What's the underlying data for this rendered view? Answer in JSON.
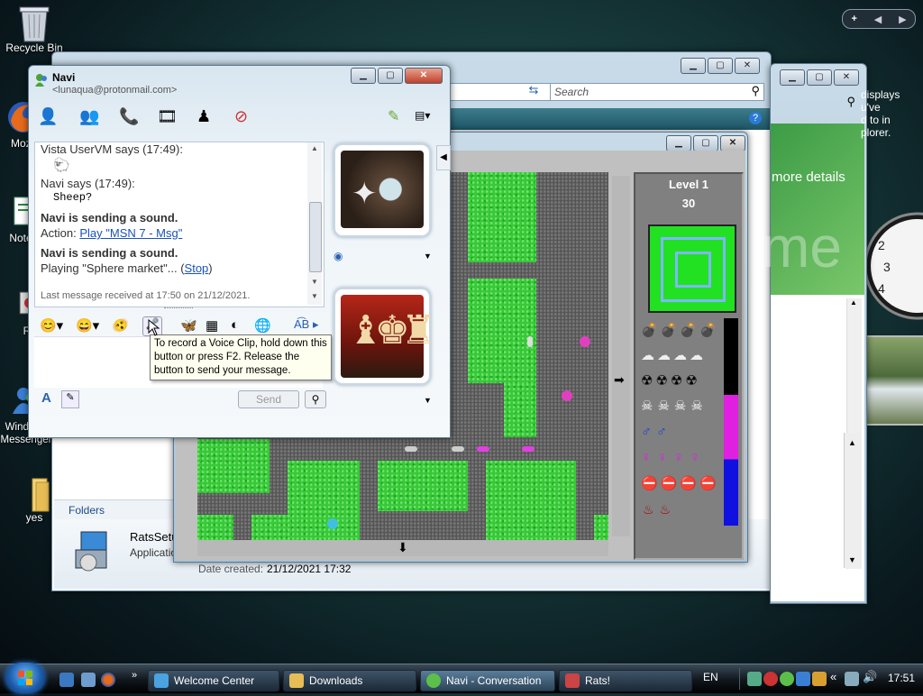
{
  "desktop": {
    "icons": [
      {
        "label": "Recycle Bin"
      },
      {
        "label": "Mozilla Firefox"
      },
      {
        "label": "Notes"
      },
      {
        "label": "R"
      },
      {
        "label": "Windows Messenger"
      },
      {
        "label": "yes"
      }
    ],
    "gadget_text": [
      "displays",
      "u've",
      "d to in",
      "plorer."
    ],
    "gadget_top_buttons": [
      "+",
      "◀",
      "▶"
    ]
  },
  "explorer": {
    "search_placeholder": "Search",
    "more_details": "more details",
    "folders_label": "Folders",
    "file_name": "RatsSetup",
    "file_type": "Application",
    "date_created_label": "Date created:",
    "date_created_value": "21/12/2021 17:32",
    "watermark": "me"
  },
  "messenger": {
    "title": "Navi",
    "email": "<lunaqua@protonmail.com>",
    "messages": [
      {
        "header": "Vista UserVM says (17:49):"
      },
      {
        "header": "Navi says (17:49):",
        "body": "Sheep?"
      }
    ],
    "sound1_bold": "Navi is sending a sound.",
    "sound1_action_label": "Action:",
    "sound1_action_link": "Play \"MSN 7 - Msg\"",
    "sound2_bold": "Navi is sending a sound.",
    "sound2_playing": "Playing \"Sphere market\"...",
    "sound2_stop": "Stop",
    "status": "Last message received at 17:50 on 21/12/2021.",
    "tooltip": "To record a Voice Clip, hold down this button or press F2. Release the button to send your message.",
    "send_label": "Send"
  },
  "game": {
    "level_label": "Level 1",
    "score": "30"
  },
  "taskbar": {
    "buttons": [
      {
        "label": "Welcome Center"
      },
      {
        "label": "Downloads"
      },
      {
        "label": "Navi - Conversation"
      },
      {
        "label": "Rats!"
      }
    ],
    "language": "EN",
    "clock": "17:51"
  }
}
